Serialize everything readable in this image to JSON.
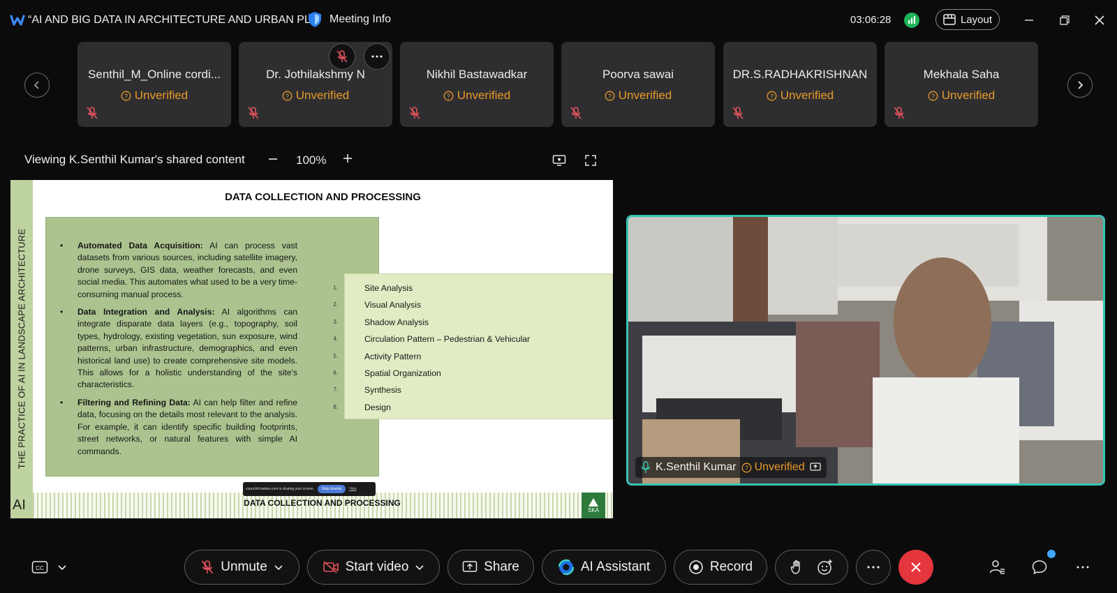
{
  "window": {
    "title": "“AI AND BIG DATA IN ARCHITECTURE AND URBAN PL...",
    "meeting_info_label": "Meeting Info",
    "clock": "03:06:28",
    "layout_label": "Layout"
  },
  "participants": [
    {
      "name": "Senthil_M_Online cordi...",
      "status": "Unverified"
    },
    {
      "name": "Dr. Jothilakshmy N",
      "status": "Unverified"
    },
    {
      "name": "Nikhil Bastawadkar",
      "status": "Unverified"
    },
    {
      "name": "Poorva sawai",
      "status": "Unverified"
    },
    {
      "name": "DR.S.RADHAKRISHNAN",
      "status": "Unverified"
    },
    {
      "name": "Mekhala Saha",
      "status": "Unverified"
    }
  ],
  "share": {
    "label": "Viewing K.Senthil Kumar's shared content",
    "zoom": "100%"
  },
  "slide": {
    "side_title": "THE PRACTICE OF AI IN LANDSCAPE ARCHITECTURE",
    "title": "DATA COLLECTION AND PROCESSING",
    "bullets": [
      {
        "heading": "Automated Data Acquisition:",
        "text": " AI can process vast datasets from various sources, including satellite imagery, drone surveys, GIS data, weather forecasts, and even social media. This automates what used to be a very time-consuming manual process."
      },
      {
        "heading": "Data Integration and Analysis:",
        "text": " AI algorithms can integrate disparate data layers (e.g., topography, soil types, hydrology, existing vegetation, sun exposure, wind patterns, urban infrastructure, demographics, and even historical land use) to create comprehensive site models. This allows for a holistic understanding of the site's characteristics."
      },
      {
        "heading": "Filtering and Refining Data:",
        "text": " AI can help filter and refine data, focusing on the details most relevant to the analysis. For example, it can identify specific building footprints, street networks, or natural features with simple AI commands."
      }
    ],
    "list": [
      {
        "num": "1.",
        "text": "Site Analysis"
      },
      {
        "num": "2.",
        "text": "Visual Analysis"
      },
      {
        "num": "3.",
        "text": "Shadow Analysis"
      },
      {
        "num": "4.",
        "text": "Circulation Pattern – Pedestrian & Vehicular"
      },
      {
        "num": "5.",
        "text": "Activity Pattern"
      },
      {
        "num": "6.",
        "text": "Spatial Organization"
      },
      {
        "num": "7.",
        "text": "Synthesis"
      },
      {
        "num": "8.",
        "text": "Design"
      }
    ],
    "footer_ai": "AI",
    "footer_text": "DATA COLLECTION AND PROCESSING",
    "logo_text": "SKA",
    "sharing_bar": {
      "text": "councilof.webex.com is sharing your screen.",
      "stop_label": "Stop sharing",
      "hide_label": "Hide"
    }
  },
  "video": {
    "name": "K.Senthil Kumar",
    "status": "Unverified"
  },
  "toolbar": {
    "unmute_label": "Unmute",
    "start_video_label": "Start video",
    "share_label": "Share",
    "ai_assistant_label": "AI Assistant",
    "record_label": "Record"
  },
  "colors": {
    "accent_teal": "#36c6b4",
    "unverified_orange": "#e89a2a",
    "end_call_red": "#e5353d",
    "signal_green": "#21b35a"
  }
}
